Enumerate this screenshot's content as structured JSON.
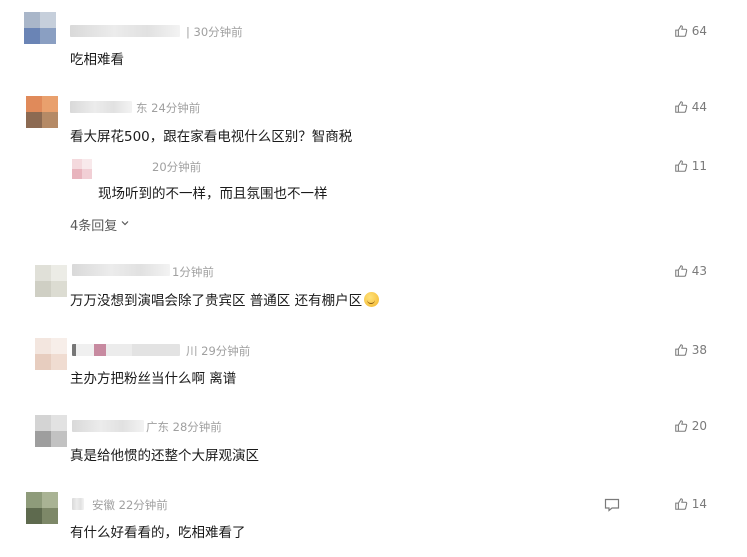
{
  "comments": [
    {
      "location": "",
      "time": "30分钟前",
      "text": "吃相难看",
      "likes": "64"
    },
    {
      "location": "东",
      "time": "24分钟前",
      "text": "看大屏花500，跟在家看电视什么区别？智商税",
      "likes": "44"
    },
    {
      "location": "",
      "time": "20分钟前",
      "text": "现场听到的不一样，而且氛围也不一样",
      "likes": "11"
    },
    {
      "location": "",
      "time": "1分钟前",
      "text": "万万没想到演唱会除了贵宾区 普通区 还有棚户区",
      "likes": "43"
    },
    {
      "location": "川",
      "time": "29分钟前",
      "text": "主办方把粉丝当什么啊 离谱",
      "likes": "38"
    },
    {
      "location": "广东",
      "time": "28分钟前",
      "text": "真是给他惯的还整个大屏观演区",
      "likes": "20"
    },
    {
      "location": "安徽",
      "time": "22分钟前",
      "text": "有什么好看看的，吃相难看了",
      "likes": "14"
    }
  ],
  "reply_count_label": "4条回复",
  "icons": {
    "like": "thumbs-up-icon",
    "reply": "comment-bubble-icon",
    "expand": "chevron-down-icon"
  },
  "colors": {
    "meta": "#a0a0a0",
    "text": "#1a1a1a",
    "like": "#7a7a7a"
  }
}
